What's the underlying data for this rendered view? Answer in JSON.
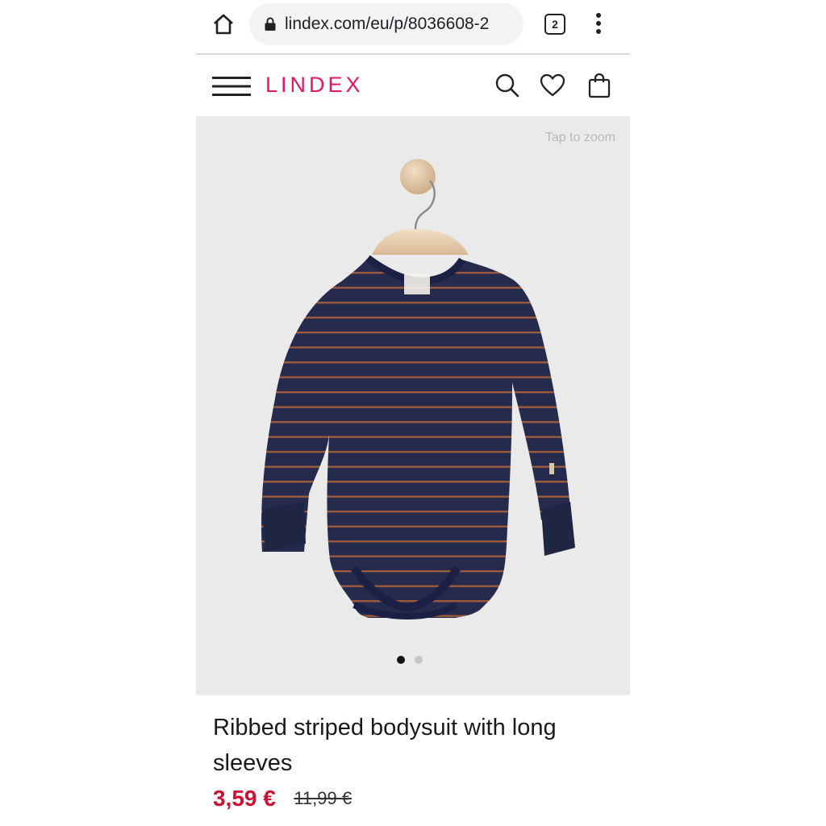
{
  "browser": {
    "url": "lindex.com/eu/p/8036608-2",
    "tab_count": "2"
  },
  "header": {
    "logo": "LINDEX",
    "icons": [
      "menu-icon",
      "search-icon",
      "heart-icon",
      "shopping-bag-icon"
    ]
  },
  "image": {
    "zoom_hint": "Tap to zoom",
    "carousel": {
      "count": 2,
      "active": 1
    }
  },
  "product": {
    "title": "Ribbed striped bodysuit with long sleeves",
    "price_sale": "3,59 €",
    "price_original": "11,99 €"
  },
  "colors": {
    "brand": "#e1185d",
    "sale_price": "#cc1133",
    "image_bg": "#ebeaea",
    "garment_navy": "#262b4e",
    "garment_stripe": "#9a5a3c"
  }
}
